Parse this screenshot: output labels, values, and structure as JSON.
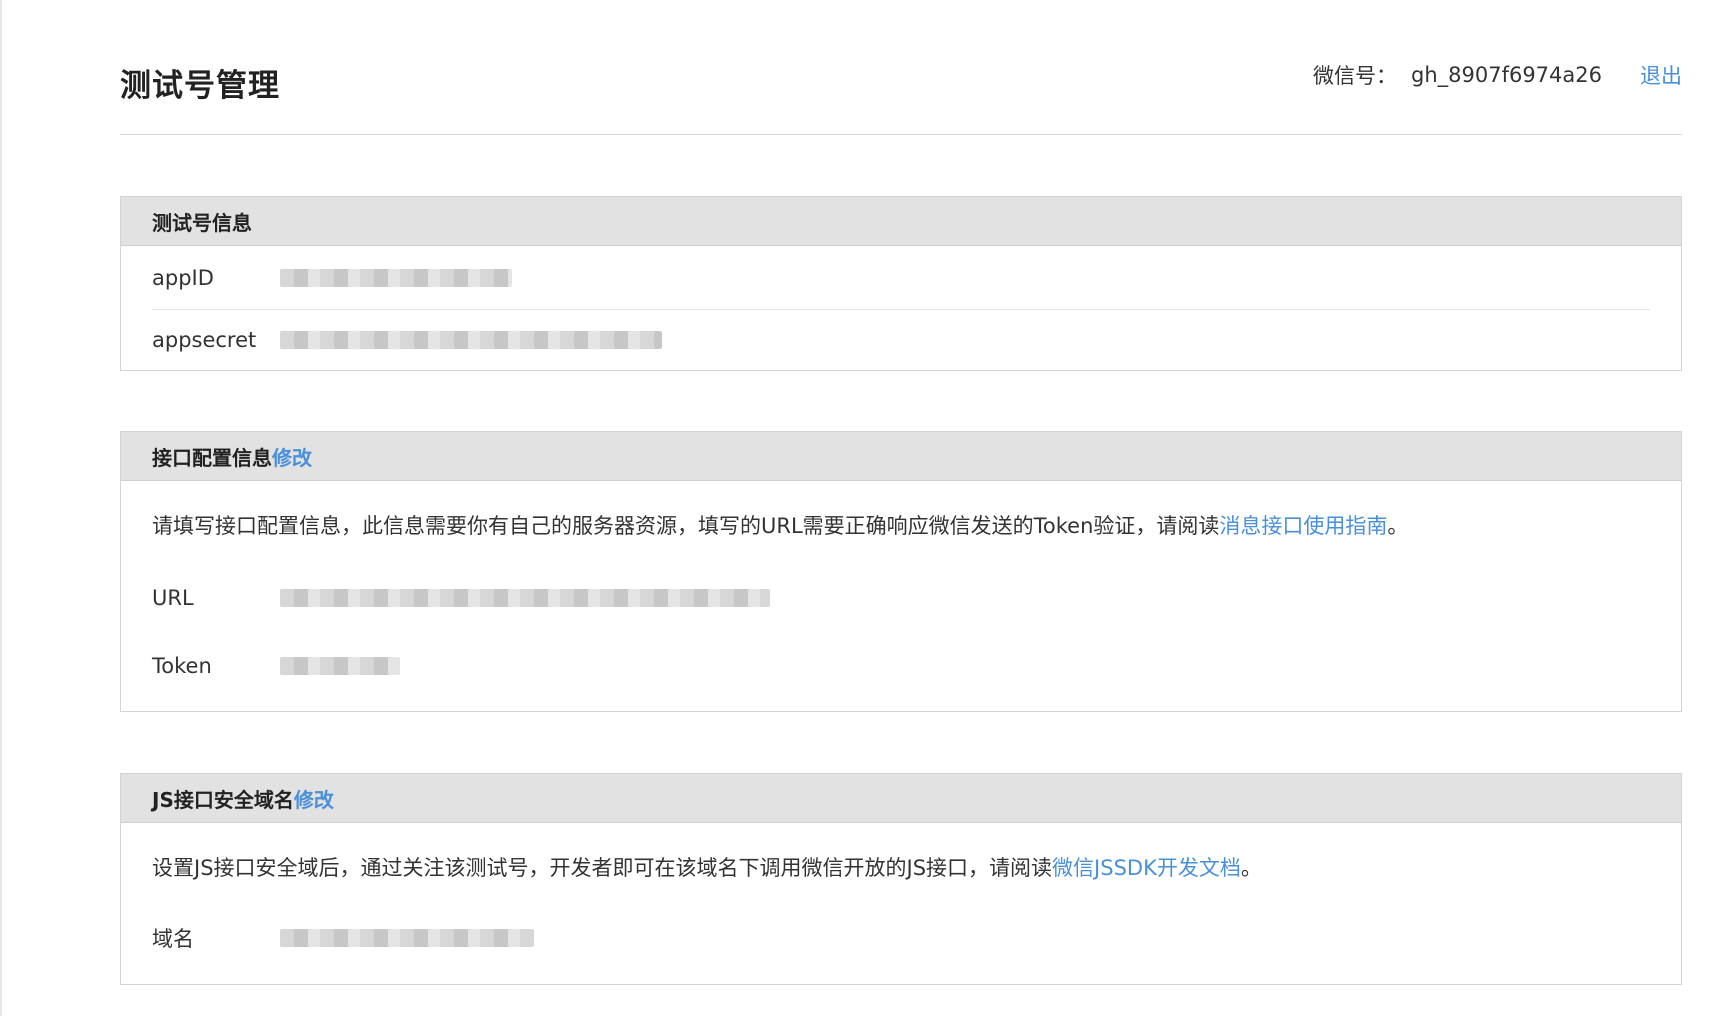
{
  "header": {
    "title": "测试号管理",
    "account_label": "微信号：",
    "account_value": "gh_8907f6974a26",
    "logout_label": "退出"
  },
  "panels": {
    "info": {
      "title": "测试号信息",
      "rows": [
        {
          "key": "appID"
        },
        {
          "key": "appsecret"
        }
      ]
    },
    "interface": {
      "title": "接口配置信息",
      "edit_label": "修改",
      "desc_text": "请填写接口配置信息，此信息需要你有自己的服务器资源，填写的URL需要正确响应微信发送的Token验证，请阅读",
      "desc_link": "消息接口使用指南",
      "desc_end": "。",
      "rows": [
        {
          "key": "URL"
        },
        {
          "key": "Token"
        }
      ]
    },
    "jsdomain": {
      "title": "JS接口安全域名",
      "edit_label": "修改",
      "desc_text": "设置JS接口安全域后，通过关注该测试号，开发者即可在该域名下调用微信开放的JS接口，请阅读",
      "desc_link": "微信JSSDK开发文档",
      "desc_end": "。",
      "rows": [
        {
          "key": "域名"
        }
      ]
    }
  },
  "colors": {
    "link": "#4a90d9",
    "panel_header_bg": "#e2e2e2"
  }
}
